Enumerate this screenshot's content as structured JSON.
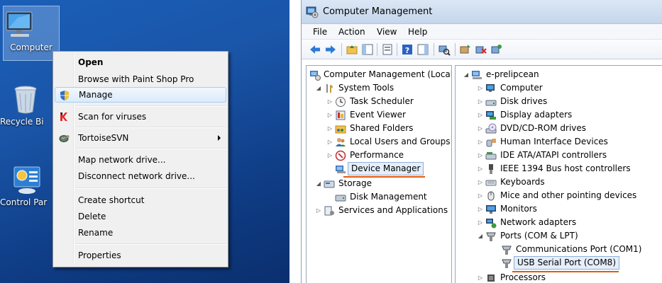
{
  "desktop": {
    "icons": [
      {
        "label": "Computer"
      },
      {
        "label": "Recycle Bi"
      },
      {
        "label": "Control Par"
      }
    ]
  },
  "context_menu": {
    "items": [
      {
        "label": "Open",
        "bold": true
      },
      {
        "label": "Browse with Paint Shop Pro"
      },
      {
        "label": "Manage",
        "highlighted": true,
        "icon": "shield-icon"
      },
      {
        "label": "Scan for viruses",
        "icon": "kaspersky-k-icon"
      },
      {
        "label": "TortoiseSVN",
        "icon": "tortoise-icon",
        "submenu": true
      },
      {
        "label": "Map network drive..."
      },
      {
        "label": "Disconnect network drive..."
      },
      {
        "label": "Create shortcut"
      },
      {
        "label": "Delete"
      },
      {
        "label": "Rename"
      },
      {
        "label": "Properties"
      }
    ]
  },
  "window": {
    "title": "Computer Management",
    "menu": [
      "File",
      "Action",
      "View",
      "Help"
    ],
    "left_tree": [
      {
        "label": "Computer Management (Local"
      },
      {
        "label": "System Tools"
      },
      {
        "label": "Task Scheduler"
      },
      {
        "label": "Event Viewer"
      },
      {
        "label": "Shared Folders"
      },
      {
        "label": "Local Users and Groups"
      },
      {
        "label": "Performance"
      },
      {
        "label": "Device Manager",
        "selected": true
      },
      {
        "label": "Storage"
      },
      {
        "label": "Disk Management"
      },
      {
        "label": "Services and Applications"
      }
    ],
    "right_tree": [
      {
        "label": "e-prelipcean"
      },
      {
        "label": "Computer"
      },
      {
        "label": "Disk drives"
      },
      {
        "label": "Display adapters"
      },
      {
        "label": "DVD/CD-ROM drives"
      },
      {
        "label": "Human Interface Devices"
      },
      {
        "label": "IDE ATA/ATAPI controllers"
      },
      {
        "label": "IEEE 1394 Bus host controllers"
      },
      {
        "label": "Keyboards"
      },
      {
        "label": "Mice and other pointing devices"
      },
      {
        "label": "Monitors"
      },
      {
        "label": "Network adapters"
      },
      {
        "label": "Ports (COM & LPT)"
      },
      {
        "label": "Communications Port (COM1)"
      },
      {
        "label": "USB Serial Port (COM8)",
        "selected": true
      },
      {
        "label": "Processors"
      }
    ]
  },
  "colors": {
    "desktop_blue": "#1a55a8",
    "highlight_border": "#a7cef5",
    "underline_orange": "#e05a12"
  }
}
